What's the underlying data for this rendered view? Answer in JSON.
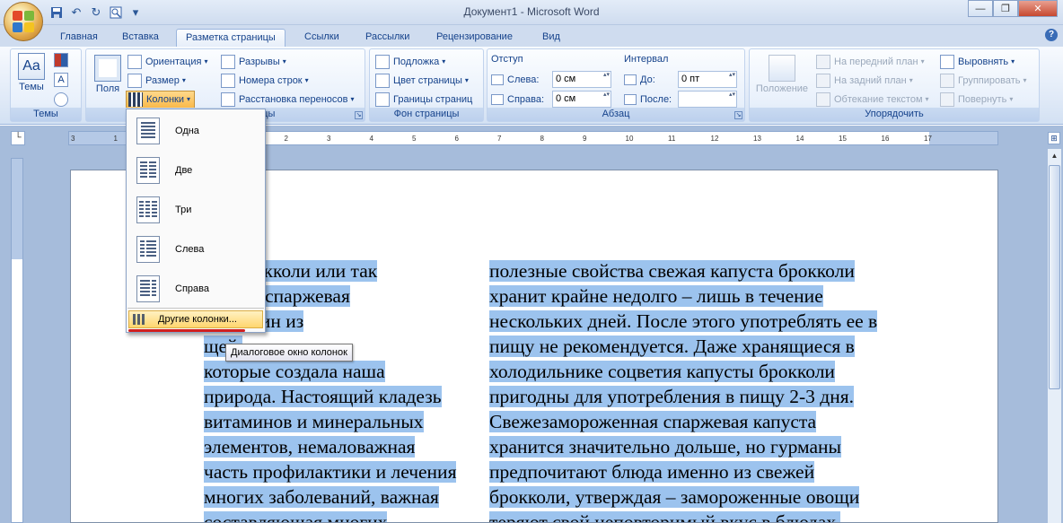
{
  "window": {
    "title": "Документ1 - Microsoft Word",
    "minimize": "—",
    "maximize": "❐",
    "close": "✕"
  },
  "qat": {
    "save_icon": "save-icon",
    "undo_icon": "undo-icon",
    "redo_icon": "redo-icon",
    "print_icon": "print-preview-icon",
    "more": "▾"
  },
  "tabs": [
    {
      "label": "Главная"
    },
    {
      "label": "Вставка"
    },
    {
      "label": "Разметка страницы",
      "active": true
    },
    {
      "label": "Ссылки"
    },
    {
      "label": "Рассылки"
    },
    {
      "label": "Рецензирование"
    },
    {
      "label": "Вид"
    }
  ],
  "help": "?",
  "ribbon": {
    "themes": {
      "label": "Темы",
      "button": "Темы"
    },
    "page_setup": {
      "label": "Параметры страницы",
      "fields_button": "Поля",
      "orientation": "Ориентация",
      "size": "Размер",
      "columns": "Колонки",
      "breaks": "Разрывы",
      "line_numbers": "Номера строк",
      "hyphenation": "Расстановка переносов"
    },
    "page_background": {
      "label": "Фон страницы",
      "watermark": "Подложка",
      "page_color": "Цвет страницы",
      "page_borders": "Границы страниц"
    },
    "paragraph": {
      "label": "Абзац",
      "indent_head": "Отступ",
      "indent_left_label": "Слева:",
      "indent_left_value": "0 см",
      "indent_right_label": "Справа:",
      "indent_right_value": "0 см",
      "spacing_head": "Интервал",
      "spacing_before_label": "До:",
      "spacing_before_value": "0 пт",
      "spacing_after_label": "После:",
      "spacing_after_value": ""
    },
    "arrange": {
      "label": "Упорядочить",
      "position": "Положение",
      "bring_front": "На передний план",
      "send_back": "На задний план",
      "text_wrap": "Обтекание текстом",
      "align": "Выровнять",
      "group": "Группировать",
      "rotate": "Повернуть"
    }
  },
  "ruler": {
    "ticks": [
      "3",
      "1",
      "2",
      "1",
      "1",
      "2",
      "3",
      "4",
      "5",
      "6",
      "7",
      "8",
      "9",
      "10",
      "11",
      "12",
      "13",
      "14",
      "15",
      "16",
      "17"
    ]
  },
  "columns_menu": {
    "items": [
      {
        "label": "Одна"
      },
      {
        "label": "Две"
      },
      {
        "label": "Три"
      },
      {
        "label": "Слева"
      },
      {
        "label": "Справа"
      }
    ],
    "more": "Другие колонки...",
    "tooltip": "Диалоговое окно колонок"
  },
  "document": {
    "column1": [
      "ста брокколи или так",
      "аемая «спаржевая",
      "а» – один из",
      "щей,",
      "которые создала наша",
      "природа. Настоящий кладезь",
      "витаминов и минеральных",
      "элементов, немаловажная",
      "часть профилактики и лечения",
      "многих заболеваний, важная",
      "составляющая многих"
    ],
    "column2": [
      "полезные свойства свежая капуста брокколи",
      "хранит крайне недолго – лишь в течение",
      "нескольких дней. После этого употреблять ее в",
      "пищу не рекомендуется. Даже хранящиеся в",
      "холодильнике соцветия капусты брокколи",
      "пригодны для употребления в пищу 2-3 дня.",
      "Свежезамороженная спаржевая капуста",
      "хранится значительно дольше, но гурманы",
      "предпочитают блюда именно из свежей",
      "брокколи, утверждая – замороженные овощи",
      "теряют свой неповторимый вкус в блюдах."
    ]
  }
}
